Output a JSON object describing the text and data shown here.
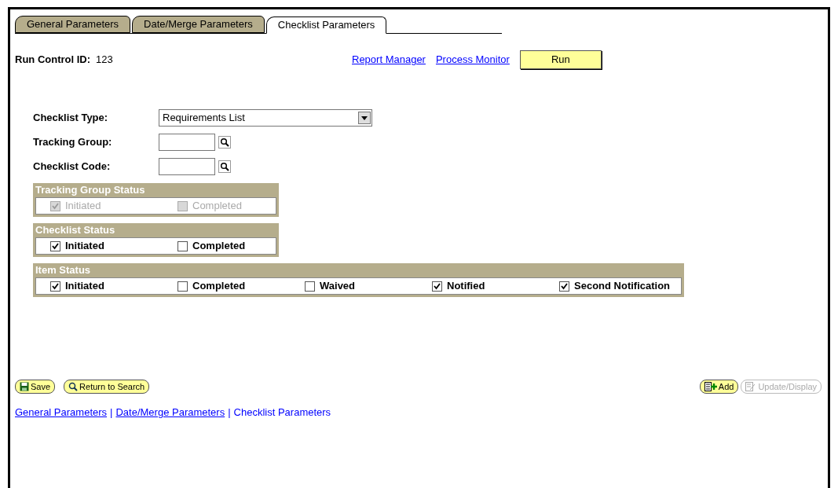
{
  "tabs": [
    {
      "label": "General Parameters",
      "selected": false
    },
    {
      "label": "Date/Merge Parameters",
      "selected": false
    },
    {
      "label": "Checklist Parameters",
      "selected": true
    }
  ],
  "run_control": {
    "label": "Run Control ID:",
    "value": "123"
  },
  "links": [
    "Report Manager",
    "Process Monitor"
  ],
  "run_button": "Run",
  "fields": [
    {
      "kind": "dropdown",
      "label": "Checklist Type:",
      "value": "Requirements List"
    },
    {
      "kind": "lookup",
      "label": "Tracking Group:"
    },
    {
      "kind": "lookup",
      "label": "Checklist Code:"
    }
  ],
  "groups": [
    {
      "title": "Tracking Group Status",
      "disabled": true,
      "items": [
        {
          "label": "Initiated",
          "checked": true
        },
        {
          "label": "Completed",
          "checked": false
        }
      ]
    },
    {
      "title": "Checklist Status",
      "disabled": false,
      "items": [
        {
          "label": "Initiated",
          "checked": true
        },
        {
          "label": "Completed",
          "checked": false
        }
      ]
    },
    {
      "title": "Item Status",
      "disabled": false,
      "items": [
        {
          "label": "Initiated",
          "checked": true
        },
        {
          "label": "Completed",
          "checked": false
        },
        {
          "label": "Waived",
          "checked": false
        },
        {
          "label": "Notified",
          "checked": true
        },
        {
          "label": "Second Notification",
          "checked": true
        }
      ]
    }
  ],
  "left_buttons": [
    {
      "kind": "save",
      "label": "Save",
      "disabled": false
    },
    {
      "kind": "search",
      "label": "Return to Search",
      "disabled": false
    }
  ],
  "right_buttons": [
    {
      "kind": "add",
      "label": "Add",
      "disabled": false
    },
    {
      "kind": "update",
      "label": "Update/Display",
      "disabled": true
    }
  ],
  "bottom_links": [
    {
      "label": "General Parameters",
      "selected": false
    },
    {
      "label": "Date/Merge Parameters",
      "selected": false
    },
    {
      "label": "Checklist Parameters",
      "selected": true
    }
  ],
  "separator": "|"
}
